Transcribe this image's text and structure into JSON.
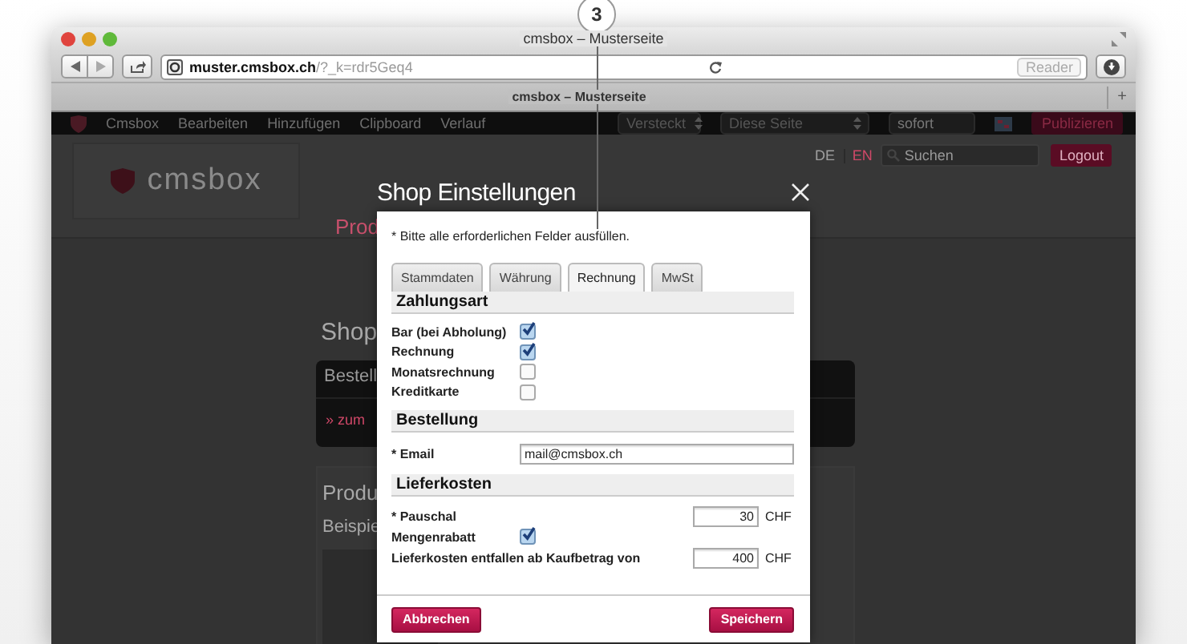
{
  "browser": {
    "title": "cmsbox – Musterseite",
    "url_host": "muster.cmsbox.ch",
    "url_path": "/?_k=rdr5Geq4",
    "reader": "Reader",
    "tab": "cmsbox – Musterseite",
    "new_tab": "+"
  },
  "callout": {
    "label": "3"
  },
  "cms_toolbar": {
    "menu": [
      "Cmsbox",
      "Bearbeiten",
      "Hinzufügen",
      "Clipboard",
      "Verlauf"
    ],
    "visibility_select": "Versteckt",
    "scope_select": "Diese Seite",
    "publish_time": "sofort",
    "publish_button": "Publizieren"
  },
  "site_header": {
    "logo": "cmsbox",
    "nav_item": "Prod",
    "languages": [
      {
        "label": "DE",
        "selected": true
      },
      {
        "label": "EN",
        "selected": false
      }
    ],
    "search": {
      "placeholder": "Suchen"
    },
    "logout": "Logout"
  },
  "page": {
    "heading": "Shop",
    "box_title": "Bestell",
    "box_link": "» zum",
    "section_heading": "Produ",
    "section_text": "Beispie"
  },
  "modal": {
    "title": "Shop Einstellungen",
    "note": "* Bitte alle erforderlichen Felder ausfüllen.",
    "tabs": [
      {
        "label": "Stammdaten",
        "selected": false
      },
      {
        "label": "Währung",
        "selected": false
      },
      {
        "label": "Rechnung",
        "selected": true
      },
      {
        "label": "MwSt",
        "selected": false
      }
    ],
    "sections": [
      {
        "title": "Zahlungsart",
        "rows": [
          {
            "kind": "checkbox",
            "label": "Bar (bei Abholung)",
            "checked": true
          },
          {
            "kind": "checkbox",
            "label": "Rechnung",
            "checked": true
          },
          {
            "kind": "checkbox",
            "label": "Monatsrechnung",
            "checked": false
          },
          {
            "kind": "checkbox",
            "label": "Kreditkarte",
            "checked": false
          }
        ]
      },
      {
        "title": "Bestellung",
        "rows": [
          {
            "kind": "text",
            "label": "* Email",
            "value": "mail@cmsbox.ch"
          }
        ]
      },
      {
        "title": "Lieferkosten",
        "rows": [
          {
            "kind": "amount",
            "label": "* Pauschal",
            "value": "30",
            "unit": "CHF"
          },
          {
            "kind": "checkbox",
            "label": "Mengenrabatt",
            "checked": true
          },
          {
            "kind": "amount",
            "label": "Lieferkosten entfallen ab Kaufbetrag von",
            "value": "400",
            "unit": "CHF"
          }
        ]
      }
    ],
    "cancel": "Abbrechen",
    "save": "Speichern"
  }
}
